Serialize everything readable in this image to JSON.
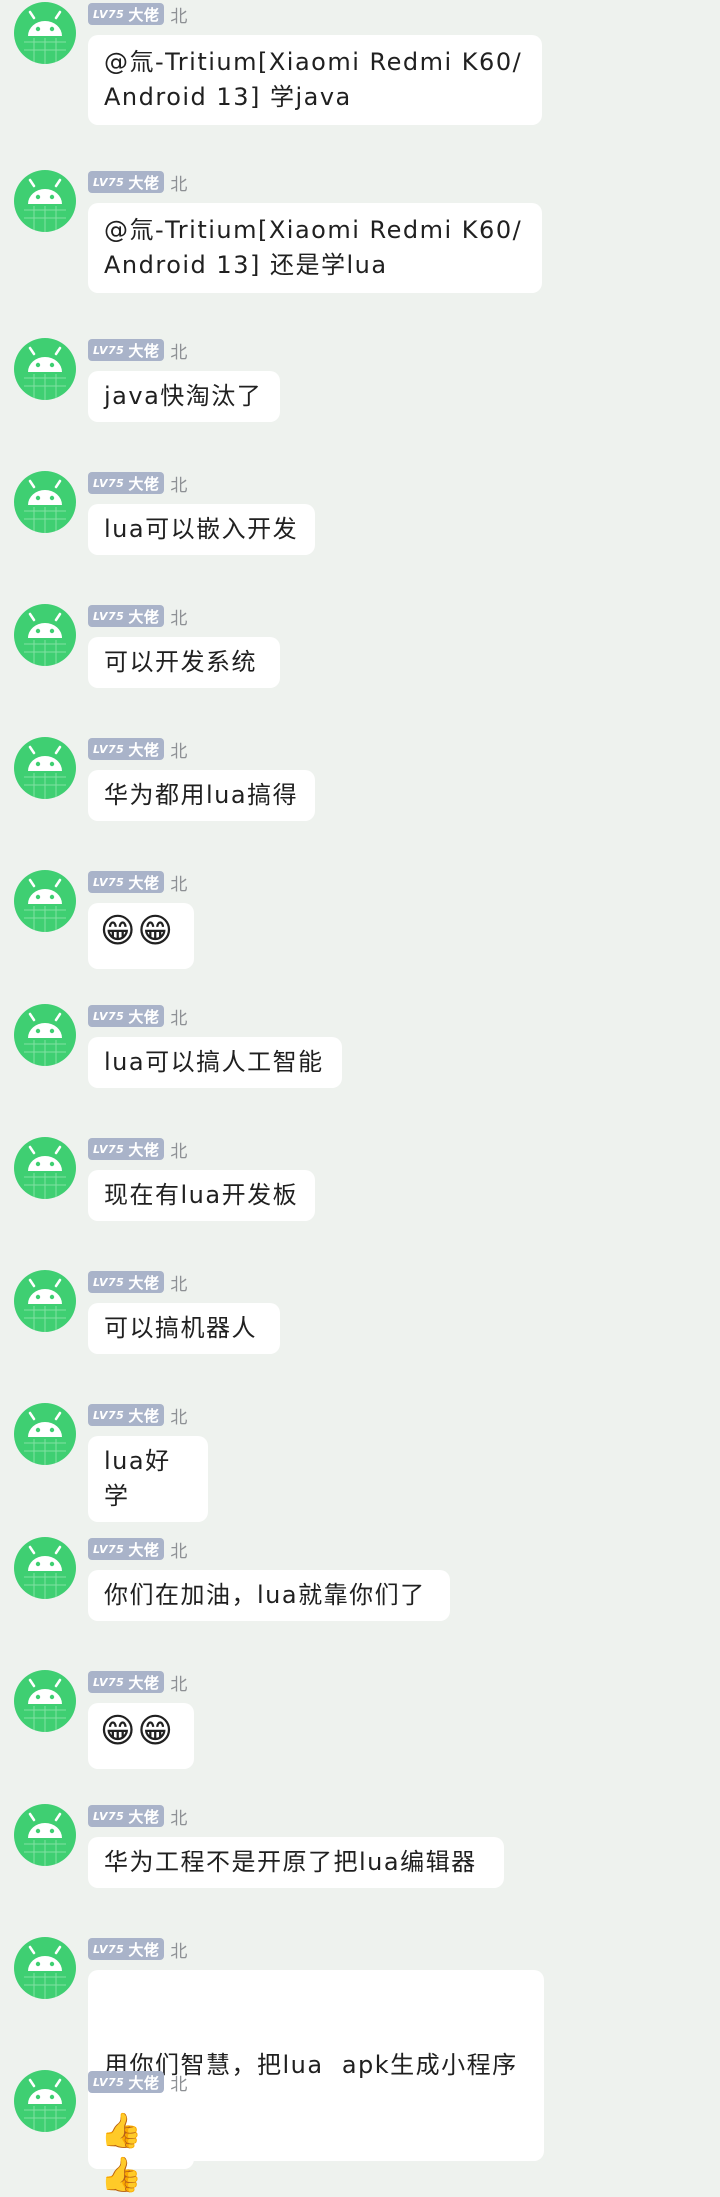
{
  "user": {
    "level_prefix": "LV75",
    "title": "大佬",
    "name": "北"
  },
  "colors": {
    "background": "#eef2ee",
    "avatar": "#3fcf72",
    "badge": "#a9b3c9",
    "bubble": "#ffffff"
  },
  "messages": [
    {
      "lines": [
        "@氚-Tritium[Xiaomi Redmi K60/",
        "Android 13] 学java"
      ]
    },
    {
      "lines": [
        "@氚-Tritium[Xiaomi Redmi K60/",
        "Android 13] 还是学lua"
      ]
    },
    {
      "lines": [
        "java快淘汰了"
      ]
    },
    {
      "lines": [
        "lua可以嵌入开发"
      ]
    },
    {
      "lines": [
        "可以开发系统"
      ]
    },
    {
      "lines": [
        "华为都用lua搞得"
      ]
    },
    {
      "lines": [
        "😁😁"
      ]
    },
    {
      "lines": [
        "lua可以搞人工智能"
      ]
    },
    {
      "lines": [
        "现在有lua开发板"
      ]
    },
    {
      "lines": [
        "可以搞机器人"
      ]
    },
    {
      "lines": [
        "lua好学"
      ]
    },
    {
      "lines": [
        "你们在加油，lua就靠你们了"
      ]
    },
    {
      "lines": [
        "😁😁"
      ]
    },
    {
      "lines": [
        "华为工程不是开原了把lua编辑器"
      ]
    },
    {
      "lines": [
        "用你们智慧，把lua  apk生成小程序"
      ]
    },
    {
      "lines": [
        "👍👍"
      ]
    }
  ]
}
